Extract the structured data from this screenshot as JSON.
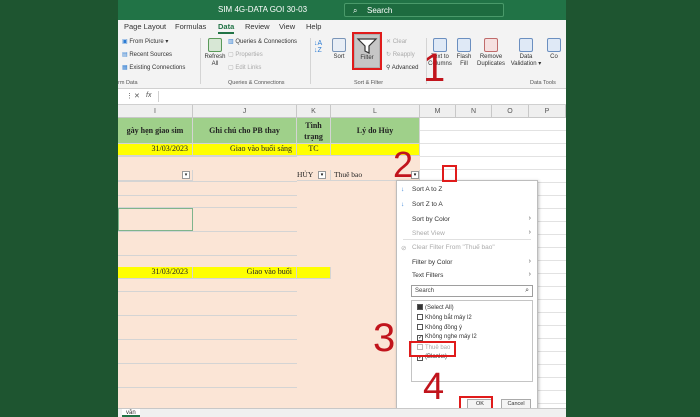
{
  "titlebar": {
    "file_name": "SIM 4G-DATA GOI 30-03",
    "search": "Search",
    "search_icon": "search-icon"
  },
  "tabs": [
    "Page Layout",
    "Formulas",
    "Data",
    "Review",
    "View",
    "Help"
  ],
  "active_tab": "Data",
  "ribbon": {
    "from_picture": "From Picture",
    "recent_sources": "Recent Sources",
    "existing_connections": "Existing Connections",
    "group_get": "rm Data",
    "refresh_all": "Refresh",
    "refresh_all_line2": "All",
    "queries_connections": "Queries & Connections",
    "properties": "Properties",
    "edit_links": "Edit Links",
    "group_queries": "Queries & Connections",
    "sort": "Sort",
    "filter": "Filter",
    "clear": "Clear",
    "reapply": "Reapply",
    "advanced": "Advanced",
    "group_sort": "Sort & Filter",
    "text_to_columns": "Text to",
    "text_to_columns_2": "Columns",
    "flash_fill": "Flash",
    "flash_fill_2": "Fill",
    "remove_duplicates": "Remove",
    "remove_duplicates_2": "Duplicates",
    "data_validation": "Data",
    "data_validation_2": "Validation",
    "consolidate": "Co",
    "group_tools": "Data Tools"
  },
  "formula_bar": {
    "fx": "fx"
  },
  "columns": [
    "I",
    "J",
    "K",
    "L",
    "M",
    "N",
    "O",
    "P"
  ],
  "headers": {
    "i": "gày hẹn giao sim",
    "j": "Ghi chú cho PB thay",
    "k1": "Tình",
    "k2": "trạng",
    "l": "Lý do Hủy"
  },
  "rows": [
    {
      "i": "31/03/2023",
      "j": "Giao vào buổi sáng",
      "k": "TC",
      "l": ""
    },
    {
      "i": "",
      "j": "",
      "k": "HỦY",
      "l": "Thuê bao"
    },
    {
      "i": "31/03/2023",
      "j": "Giao vào buổi",
      "k": "",
      "l": ""
    }
  ],
  "dropdown": {
    "sort_az": "Sort A to Z",
    "sort_za": "Sort Z to A",
    "sort_by_color": "Sort by Color",
    "sheet_view": "Sheet View",
    "clear_filter": "Clear Filter From \"Thuế bao\"",
    "filter_by_color": "Filter by Color",
    "text_filters": "Text Filters",
    "search_placeholder": "Search",
    "items": [
      {
        "label": "(Select All)",
        "state": "partial"
      },
      {
        "label": "Không bắt máy l2",
        "state": "unchecked"
      },
      {
        "label": "Không đồng ý",
        "state": "unchecked"
      },
      {
        "label": "Không nghe máy l2",
        "state": "checked"
      },
      {
        "label": "Thuê bao",
        "state": "unchecked"
      },
      {
        "label": "(Blanks)",
        "state": "checked"
      }
    ],
    "ok": "OK",
    "cancel": "Cancel"
  },
  "annotations": [
    "1",
    "2",
    "3",
    "4"
  ],
  "sheet_tab": "văn"
}
